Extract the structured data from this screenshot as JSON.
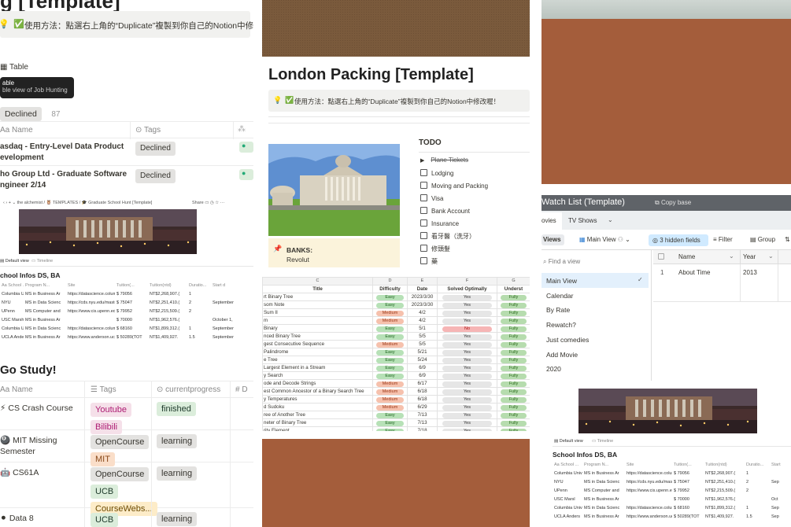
{
  "col1": {
    "page_title_fragment": "g [Template]",
    "callout_icon": "💡",
    "callout_check": "✅",
    "callout_text": "使用方法：點選右上角的“Duplicate”複製到你自己的Notion中修",
    "view_tab_label": "Table",
    "tooltip_title": "able",
    "tooltip_sub": "ble view of Job Hunting",
    "filter_tag": "Declined",
    "filter_count": "87",
    "col_name": "Name",
    "col_tags": "Tags",
    "rows": [
      {
        "name_line1": "asdaq - Entry-Level Data Product",
        "name_line2": "evelopment",
        "tag": "Declined"
      },
      {
        "name_line1": "ho Group Ltd - Graduate Software",
        "name_line2": "ngineer 2/14",
        "tag": "Declined"
      }
    ],
    "school": {
      "breadcrumb": "the alchemist / 🦉 TEMPLATES / 🎓 Graduate School Hunt [Template]",
      "share_label": "Share",
      "tab_default": "Default view",
      "tab_timeline": "Timeline",
      "db_title": "chool Infos DS, BA",
      "headers": [
        "Aa School ...",
        "Program N...",
        "Site",
        "Tuition(...",
        "Tuition(ntd)",
        "Duratio...",
        "Start d"
      ],
      "rows": [
        [
          "Columbia Univ",
          "MS in Business Ar",
          "https://datascience.columbia.",
          "$ 79056",
          "NT$2,268,907.(",
          "1",
          ""
        ],
        [
          "NYU",
          "MS in Data Scienc",
          "https://cds.nyu.edu/masters-c",
          "$ 75047",
          "NT$2,251,410.(",
          "2",
          "September"
        ],
        [
          "UPenn",
          "MS Computer and",
          "https://www.cis.upenn.edu/gra",
          "$ 79952",
          "NT$2,215,509.(",
          "2",
          ""
        ],
        [
          "USC Marsh",
          "MS in Business Ar",
          "",
          "$ 70000",
          "NT$1,962,576.(",
          "",
          "October 1,"
        ],
        [
          "Columbia Univ",
          "MS in Data Scienc",
          "https://datascience.columbia.",
          "$ 68160",
          "NT$1,899,312.(",
          "1",
          "September"
        ],
        [
          "UCLA Anders",
          "MS in Business Ar",
          "https://www.anderson.ucla.ed",
          "$ 50289(TOT",
          "NT$1,409,927.",
          "1.5",
          "September"
        ]
      ]
    },
    "study": {
      "title": "Go Study!",
      "col_name": "Name",
      "col_tags": "Tags",
      "col_progress": "currentprogress",
      "col_extra": "# D",
      "rows": [
        {
          "icon": "⚡",
          "name_line1": "CS Crash Course",
          "name_line2": "",
          "tags": [
            {
              "t": "Youtube",
              "c": "t-pink"
            },
            {
              "t": "Bilibili",
              "c": "t-pink"
            }
          ],
          "progress": "finished",
          "pc": "t-green"
        },
        {
          "icon": "🎱",
          "name_line1": "MIT Missing",
          "name_line2": "Semester",
          "tags": [
            {
              "t": "OpenCourse",
              "c": "t-gray"
            },
            {
              "t": "MIT",
              "c": "t-orange"
            }
          ],
          "progress": "learning",
          "pc": "t-gray"
        },
        {
          "icon": "🤖",
          "name_line1": "CS61A",
          "name_line2": "",
          "tags": [
            {
              "t": "OpenCourse",
              "c": "t-gray"
            },
            {
              "t": "UCB",
              "c": "t-green"
            },
            {
              "t": "CourseWebs...",
              "c": "t-yel"
            }
          ],
          "progress": "learning",
          "pc": "t-gray"
        },
        {
          "icon": "⚫",
          "name_line1": "Data 8",
          "name_line2": "",
          "tags": [
            {
              "t": "UCB",
              "c": "t-green"
            }
          ],
          "progress": "learning",
          "pc": "t-gray"
        }
      ]
    }
  },
  "col2": {
    "title": "London Packing [Template]",
    "callout_icon": "💡",
    "callout_check": "✅",
    "callout_text": "使用方法：點選右上角的“Duplicate”複製到你自己的Notion中修改喔！",
    "todo_title": "TODO",
    "todos": [
      "Plane Tickets",
      "Lodging",
      "Moving and Packing",
      "Visa",
      "Bank Account",
      "Insurance",
      "看牙醫（洗牙）",
      "修頭髮",
      "藥"
    ],
    "banks_icon": "📌",
    "banks_label": "BANKS:",
    "banks_value": "Revolut",
    "sheet": {
      "letters": [
        "C",
        "D",
        "E",
        "F",
        "G"
      ],
      "headers": [
        "Title",
        "Difficulty",
        "Date",
        "Solved Optimally",
        "Underst"
      ],
      "rows": [
        [
          "rt Binary Tree",
          "Easy",
          "2023/3/30",
          "Yes",
          "Fully"
        ],
        [
          "som Note",
          "Easy",
          "2023/3/30",
          "Yes",
          "Fully"
        ],
        [
          " Sum II",
          "Medium",
          "4/2",
          "Yes",
          "Fully"
        ],
        [
          "m",
          "Medium",
          "4/2",
          "Yes",
          "Fully"
        ],
        [
          " Binary",
          "Easy",
          "5/1",
          "No",
          "Fully"
        ],
        [
          "nced Binary Tree",
          "Easy",
          "5/5",
          "Yes",
          "Fully"
        ],
        [
          "gest Consecutive Sequence",
          "Medium",
          "5/5",
          "Yes",
          "Fully"
        ],
        [
          " Palindrome",
          "Easy",
          "5/21",
          "Yes",
          "Fully"
        ],
        [
          "e Tree",
          "Easy",
          "5/24",
          "Yes",
          "Fully"
        ],
        [
          "Largest Element in a Stream",
          "Easy",
          "6/9",
          "Yes",
          "Fully"
        ],
        [
          "y Search",
          "Easy",
          "6/9",
          "Yes",
          "Fully"
        ],
        [
          "ode and Decode Strings",
          "Medium",
          "6/17",
          "Yes",
          "Fully"
        ],
        [
          "est Common Ancestor of a Binary Search Tree",
          "Medium",
          "6/18",
          "Yes",
          "Fully"
        ],
        [
          "y Temperatures",
          "Medium",
          "6/18",
          "Yes",
          "Fully"
        ],
        [
          "d Sudoku",
          "Medium",
          "6/29",
          "Yes",
          "Fully"
        ],
        [
          "ree of Another Tree",
          "Easy",
          "7/13",
          "Yes",
          "Fully"
        ],
        [
          "neter of Binary Tree",
          "Easy",
          "7/13",
          "Yes",
          "Fully"
        ],
        [
          "rity Element",
          "Easy",
          "7/18",
          "Yes",
          "Fully"
        ]
      ]
    }
  },
  "col3": {
    "title": "Watch List (Template)",
    "copy_base": "Copy base",
    "tab_movies": "ovies",
    "tab_tv": "TV Shows",
    "views_btn": "Views",
    "main_view": "Main View",
    "hidden_fields": "3 hidden fields",
    "filter": "Filter",
    "group": "Group",
    "find_view": "Find a view",
    "views": [
      "Main View",
      "Calendar",
      "By Rate",
      "Rewatch?",
      "Just comedies",
      "Add Movie",
      "2020"
    ],
    "col_name": "Name",
    "col_year": "Year",
    "row_num": "1",
    "row_name": "About Time",
    "row_year": "2013",
    "school": {
      "tab_default": "Default view",
      "tab_timeline": "Timeline",
      "db_title": "School Infos DS, BA",
      "headers": [
        "Aa School ...",
        "Program N...",
        "Site",
        "Tuition(...",
        "Tuition(ntd)",
        "Duratio...",
        "Start"
      ],
      "rows": [
        [
          "Columbia Univ",
          "MS in Business Ar",
          "https://datascience.columbia.",
          "$ 79056",
          "NT$2,268,907.(",
          "1",
          ""
        ],
        [
          "NYU",
          "MS in Data Scienc",
          "https://cds.nyu.edu/masters-c",
          "$ 75047",
          "NT$2,251,410.(",
          "2",
          "Sep"
        ],
        [
          "UPenn",
          "MS Computer and",
          "https://www.cis.upenn.edu/gra",
          "$ 79952",
          "NT$2,215,509.(",
          "2",
          ""
        ],
        [
          "USC Marsl",
          "MS in Business Ar",
          "",
          "$ 70000",
          "NT$1,962,576.(",
          "",
          "Oct"
        ],
        [
          "Columbia Univ",
          "MS in Data Scienc",
          "https://datascience.columbia.",
          "$ 68160",
          "NT$1,899,312.(",
          "1",
          "Sep"
        ],
        [
          "UCLA Anders",
          "MS in Business Ar",
          "https://www.anderson.ucla.ed",
          "$ 50289(TOT",
          "NT$1,409,927.",
          "1.5",
          "Sep"
        ]
      ]
    }
  },
  "colors": {
    "brown": "#a45d3b",
    "brown_top": "#7a5a3c",
    "airtable_header": "#5f6368",
    "accent_blue": "#2e7dd1"
  }
}
